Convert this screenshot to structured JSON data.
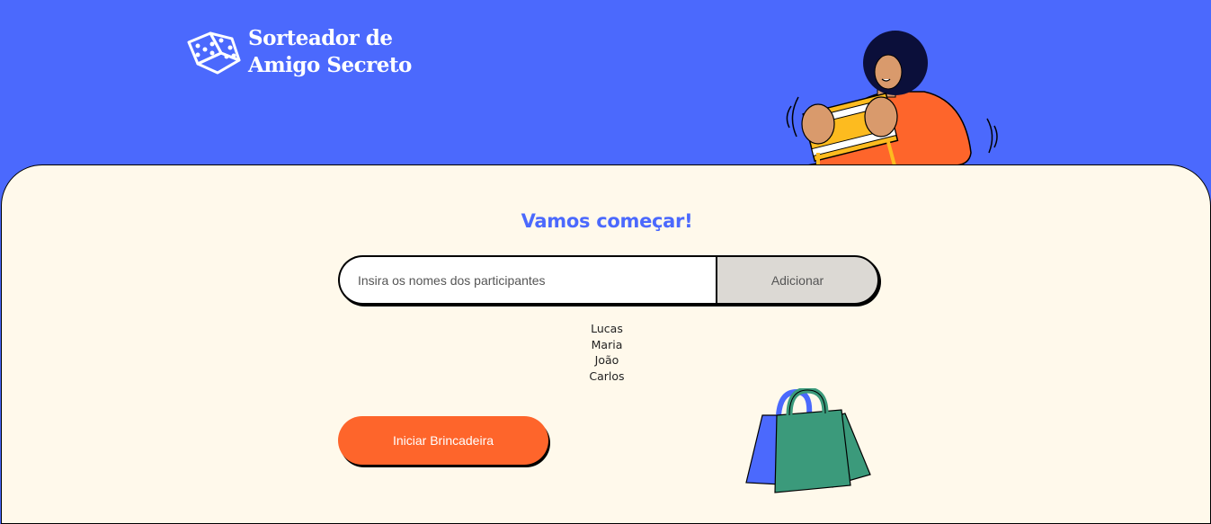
{
  "header": {
    "logo_line1": "Sorteador de",
    "logo_line2": "Amigo Secreto",
    "logo_icon": "dice-icon",
    "illustration": "person-holding-gift-illustration"
  },
  "main": {
    "title": "Vamos começar!",
    "input": {
      "value": "",
      "placeholder": "Insira os nomes dos participantes"
    },
    "add_button_label": "Adicionar",
    "participants": [
      "Lucas",
      "Maria",
      "João",
      "Carlos"
    ],
    "start_button_label": "Iniciar Brincadeira",
    "bags_illustration": "shopping-bags-illustration"
  },
  "colors": {
    "header_bg": "#4B69FD",
    "main_bg": "#FFF9EB",
    "accent": "#FE652B",
    "title": "#4B69FD"
  }
}
